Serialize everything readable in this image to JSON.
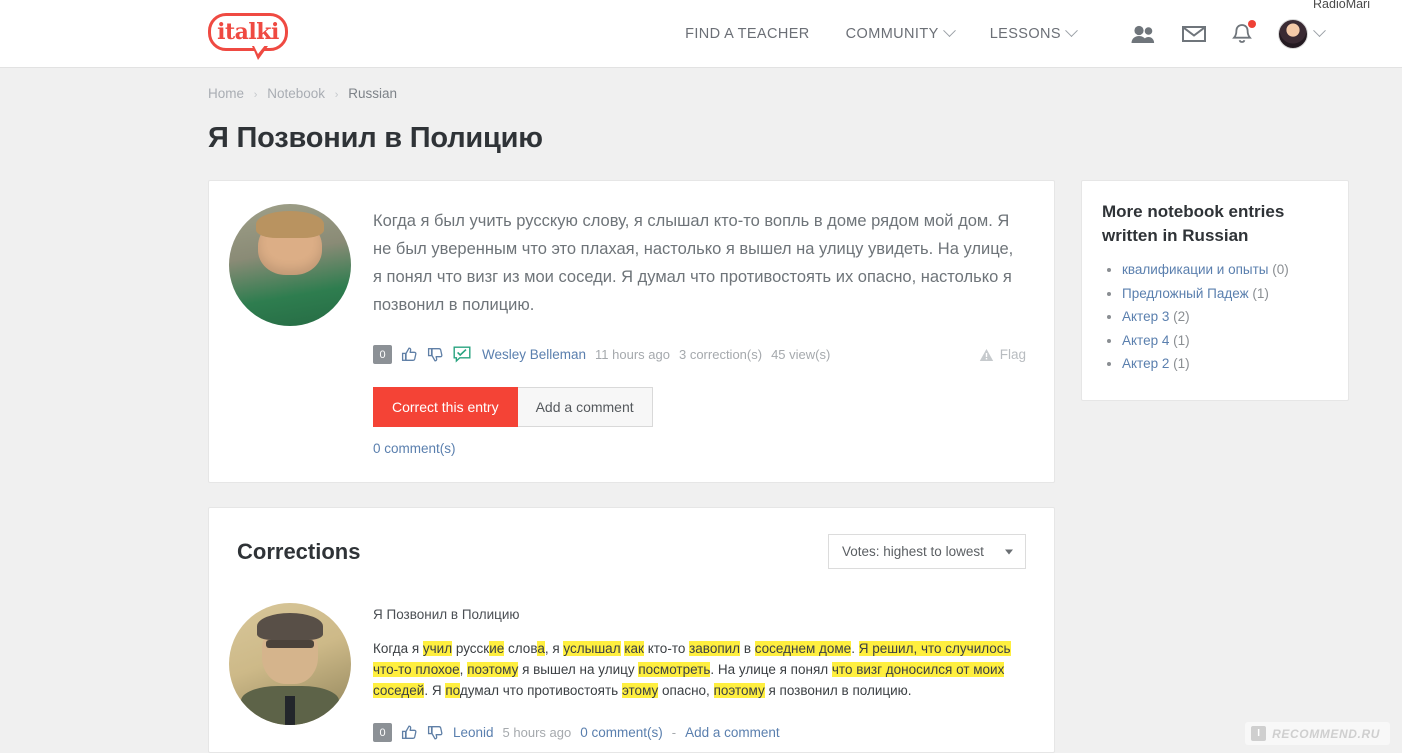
{
  "header": {
    "logo_text": "italki",
    "nav": [
      {
        "label": "FIND A TEACHER",
        "has_caret": false
      },
      {
        "label": "COMMUNITY",
        "has_caret": true
      },
      {
        "label": "LESSONS",
        "has_caret": true
      }
    ],
    "icons": [
      {
        "name": "friends-icon"
      },
      {
        "name": "mail-icon"
      },
      {
        "name": "bell-icon",
        "has_badge": true
      }
    ],
    "username": "RadioMari"
  },
  "breadcrumb": {
    "home": "Home",
    "notebook": "Notebook",
    "current": "Russian",
    "separator": "›"
  },
  "page": {
    "title": "Я Позвонил в Полицию"
  },
  "entry": {
    "text": "Когда я был учить русскую слову, я слышал кто-то вопль в доме рядом мой дом. Я не был уверенным что это плахая, настолько я вышел на улицу увидеть. На улице, я понял что визг из мои соседи. Я думал что противостоять их опасно, настолько я позвонил в полицию.",
    "votes": "0",
    "author": "Wesley Belleman",
    "time": "11 hours ago",
    "corrections_count": "3 correction(s)",
    "views": "45 view(s)",
    "flag_label": "Flag",
    "correct_button": "Correct this entry",
    "comment_button": "Add a comment",
    "comments_link": "0 comment(s)"
  },
  "corrections": {
    "title": "Corrections",
    "sort_value": "Votes: highest to lowest",
    "items": [
      {
        "entry_title": "Я Позвонил в Полицию",
        "segments": [
          {
            "t": "Когда я ",
            "h": false
          },
          {
            "t": "учил",
            "h": true
          },
          {
            "t": " русск",
            "h": false
          },
          {
            "t": "ие",
            "h": true
          },
          {
            "t": " слов",
            "h": false
          },
          {
            "t": "а",
            "h": true
          },
          {
            "t": ", я ",
            "h": false
          },
          {
            "t": "услышал",
            "h": true
          },
          {
            "t": " ",
            "h": false
          },
          {
            "t": "как",
            "h": true
          },
          {
            "t": " кто-то ",
            "h": false
          },
          {
            "t": "завопил",
            "h": true
          },
          {
            "t": " в ",
            "h": false
          },
          {
            "t": "соседнем доме",
            "h": true
          },
          {
            "t": ". ",
            "h": false
          },
          {
            "t": "Я решил, что случилось что-то плохое",
            "h": true
          },
          {
            "t": ", ",
            "h": false
          },
          {
            "t": "поэтому",
            "h": true
          },
          {
            "t": " я вышел на улицу ",
            "h": false
          },
          {
            "t": "посмотреть",
            "h": true
          },
          {
            "t": ". На улице я понял ",
            "h": false
          },
          {
            "t": "что визг доносился от моих соседей",
            "h": true
          },
          {
            "t": ". Я ",
            "h": false
          },
          {
            "t": "по",
            "h": true
          },
          {
            "t": "думал что противостоять ",
            "h": false
          },
          {
            "t": "этому",
            "h": true
          },
          {
            "t": " опасно, ",
            "h": false
          },
          {
            "t": "поэтому",
            "h": true
          },
          {
            "t": " я позвонил в полицию.",
            "h": false
          }
        ],
        "votes": "0",
        "author": "Leonid",
        "time": "5 hours ago",
        "comments_link": "0 comment(s)",
        "separator": "-",
        "add_comment": "Add a comment"
      }
    ]
  },
  "sidebar": {
    "title": "More notebook entries written in Russian",
    "items": [
      {
        "label": "квалификации и опыты",
        "count": "(0)"
      },
      {
        "label": "Предложный Падеж",
        "count": "(1)"
      },
      {
        "label": "Актер 3",
        "count": "(2)"
      },
      {
        "label": "Актер 4",
        "count": "(1)"
      },
      {
        "label": "Актер 2",
        "count": "(1)"
      }
    ]
  },
  "watermark": {
    "mark": "I",
    "text": "RECOMMEND.RU"
  },
  "colors": {
    "brand_red": "#ef4a42",
    "button_red": "#f44336",
    "link_blue": "#5a7fae",
    "highlight_yellow": "#ffef3f",
    "page_bg": "#f0f0f0"
  }
}
